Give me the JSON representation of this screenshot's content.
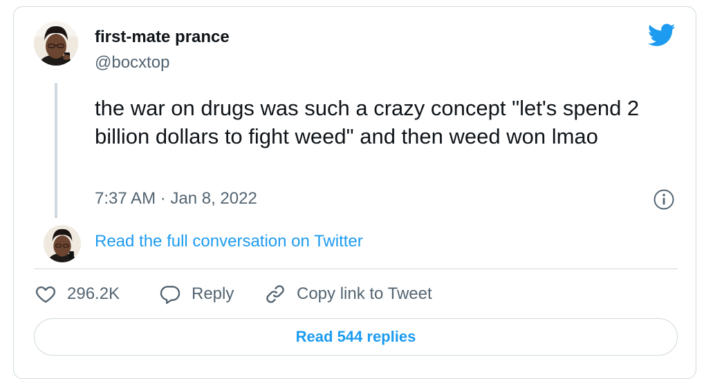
{
  "author": {
    "display_name": "first-mate prance",
    "handle": "@bocxtop"
  },
  "tweet": {
    "text": "the war on drugs was such a crazy concept \"let's spend 2 billion dollars to fight weed\" and then weed won lmao",
    "timestamp": "7:37 AM · Jan 8, 2022"
  },
  "conversation_link": "Read the full conversation on Twitter",
  "actions": {
    "like_count": "296.2K",
    "reply_label": "Reply",
    "copy_link_label": "Copy link to Tweet"
  },
  "replies_button": "Read 544 replies",
  "icons": {
    "brand": "twitter-bird-icon",
    "info": "info-icon",
    "like": "heart-icon",
    "reply": "speech-bubble-icon",
    "copy": "link-icon"
  },
  "colors": {
    "accent": "#1d9bf0",
    "text": "#0f1419",
    "secondary": "#536471",
    "border": "#cfd9de"
  }
}
